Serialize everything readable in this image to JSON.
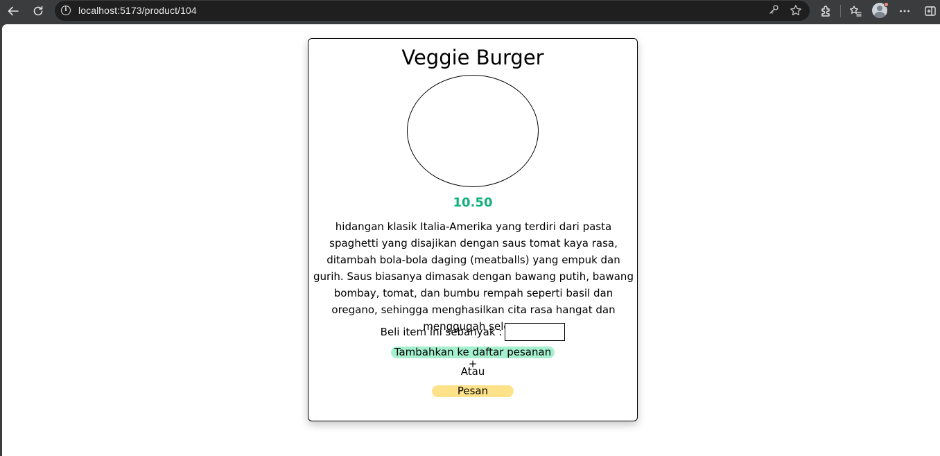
{
  "browser": {
    "url": "localhost:5173/product/104"
  },
  "product": {
    "name": "Veggie Burger",
    "price": "10.50",
    "description": "hidangan klasik Italia-Amerika yang terdiri dari pasta spaghetti yang disajikan dengan saus tomat kaya rasa, ditambah bola-bola daging (meatballs) yang empuk dan gurih. Saus biasanya dimasak dengan bawang putih, bawang bombay, tomat, dan bumbu rempah seperti basil dan oregano, sehingga menghasilkan cita rasa hangat dan menggugah selera.",
    "quantity_label": "Beli item ini sebanyak :",
    "quantity_value": "",
    "add_to_list_label": "Tambahkan ke daftar pesanan +",
    "or_label": "Atau",
    "order_label": "Pesan"
  },
  "colors": {
    "price": "#12b07a",
    "add_button_bg": "#a6f0cf",
    "order_button_bg": "#fde28a"
  }
}
